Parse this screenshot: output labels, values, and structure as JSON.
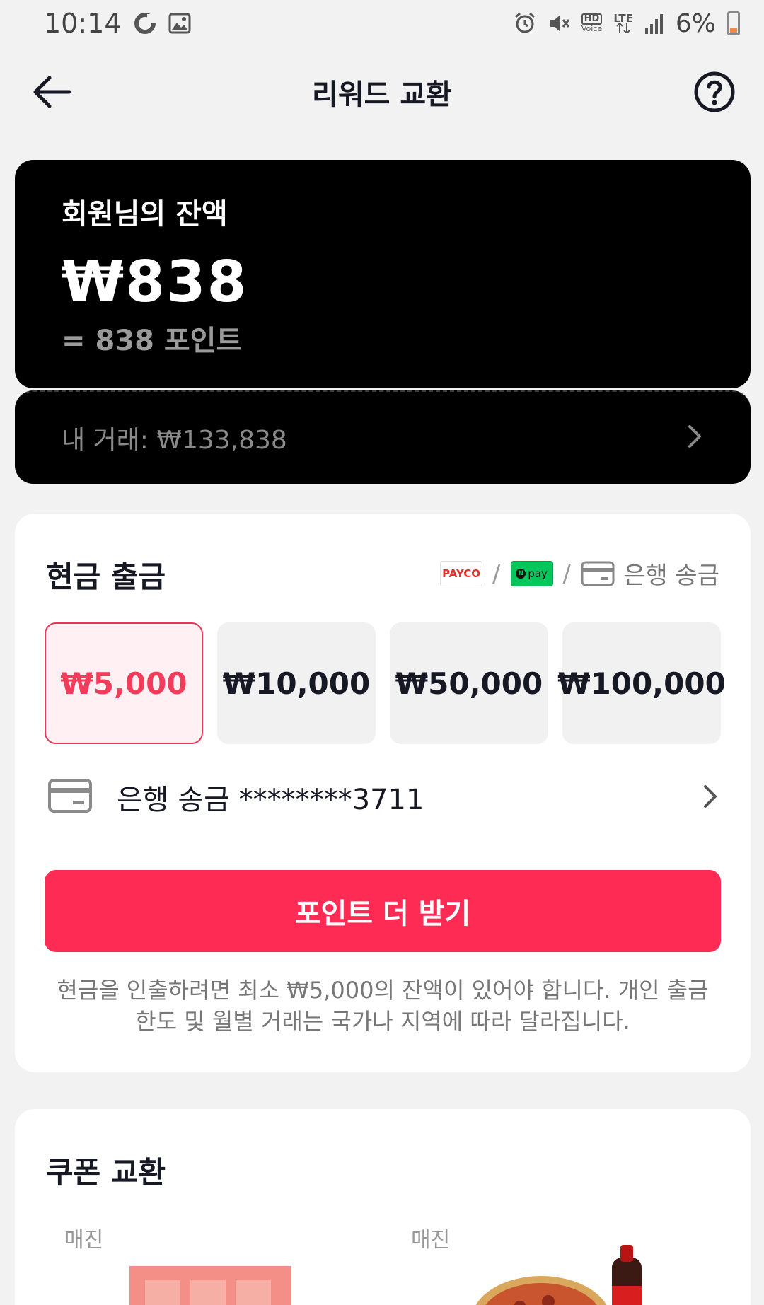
{
  "status_bar": {
    "time": "10:14",
    "battery": "6%",
    "hd_label": "HD",
    "voice_label": "Voice",
    "lte_label": "LTE"
  },
  "header": {
    "title": "리워드 교환"
  },
  "balance": {
    "label": "회원님의 잔액",
    "amount": "₩838",
    "points": "= 838 포인트"
  },
  "transactions": {
    "label": "내 거래: ₩133,838"
  },
  "cash": {
    "title": "현금 출금",
    "methods": {
      "payco": "PAYCO",
      "npay": "pay",
      "bank": "은행 송금"
    },
    "amounts": [
      "₩5,000",
      "₩10,000",
      "₩50,000",
      "₩100,000"
    ],
    "selected_index": 0,
    "bank_account": "은행 송금 ********3711",
    "cta_label": "포인트 더 받기",
    "notice": "현금을 인출하려면 최소 ₩5,000의 잔액이 있어야 합니다. 개인 출금 한도 및 월별 거래는 국가나 지역에 따라 달라집니다."
  },
  "coupon": {
    "title": "쿠폰 교환",
    "items": [
      {
        "tag": "매진"
      },
      {
        "tag": "매진"
      }
    ]
  },
  "colors": {
    "accent": "#fe2c55",
    "selected_text": "#f23c5c",
    "card_dark": "#000000"
  }
}
